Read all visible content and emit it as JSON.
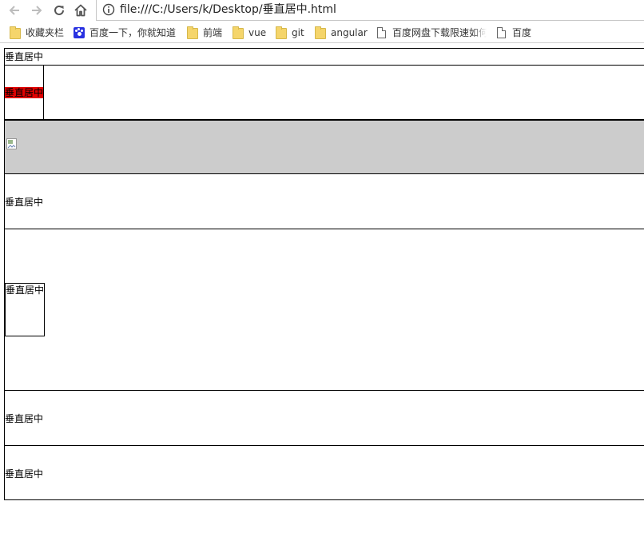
{
  "browser": {
    "address_url": "file:///C:/Users/k/Desktop/垂直居中.html",
    "bookmarks": [
      {
        "label": "收藏夹栏",
        "icon": "folder-icon"
      },
      {
        "label": "百度一下，你就知道",
        "icon": "baidu-paw-icon"
      },
      {
        "label": "前端",
        "icon": "folder-icon"
      },
      {
        "label": "vue",
        "icon": "folder-icon"
      },
      {
        "label": "git",
        "icon": "folder-icon"
      },
      {
        "label": "angular",
        "icon": "folder-icon"
      },
      {
        "label": "百度网盘下载限速如何",
        "icon": "page-icon"
      },
      {
        "label": "百度",
        "icon": "page-icon"
      }
    ]
  },
  "page": {
    "blocks": [
      {
        "text": "垂直居中"
      },
      {
        "text": "垂直居中",
        "highlight_color": "#e00000"
      },
      {
        "image": "broken-image-icon",
        "background": "#cccccc"
      },
      {
        "text": "垂直居中"
      },
      {
        "text": "垂直居中"
      },
      {
        "text": "垂直居中"
      },
      {
        "text": "垂直居中"
      }
    ]
  }
}
